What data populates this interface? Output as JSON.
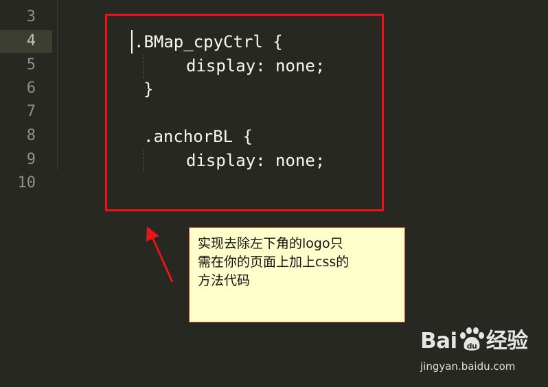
{
  "editor": {
    "line_numbers": [
      "3",
      "4",
      "5",
      "6",
      "7",
      "8",
      "9",
      "10"
    ],
    "active_line": "4",
    "code_lines": [
      ".BMap_cpyCtrl {",
      "display: none;",
      "}",
      "",
      ".anchorBL {",
      "display: none;"
    ]
  },
  "annotation": {
    "note_line1": "实现去除左下角的logo只",
    "note_line2": "需在你的页面上加上css的",
    "note_line3": "方法代码",
    "box_color": "#e8141b"
  },
  "watermark": {
    "brand_pre": "Bai",
    "brand_post": "经验",
    "url": "jingyan.baidu.com"
  }
}
